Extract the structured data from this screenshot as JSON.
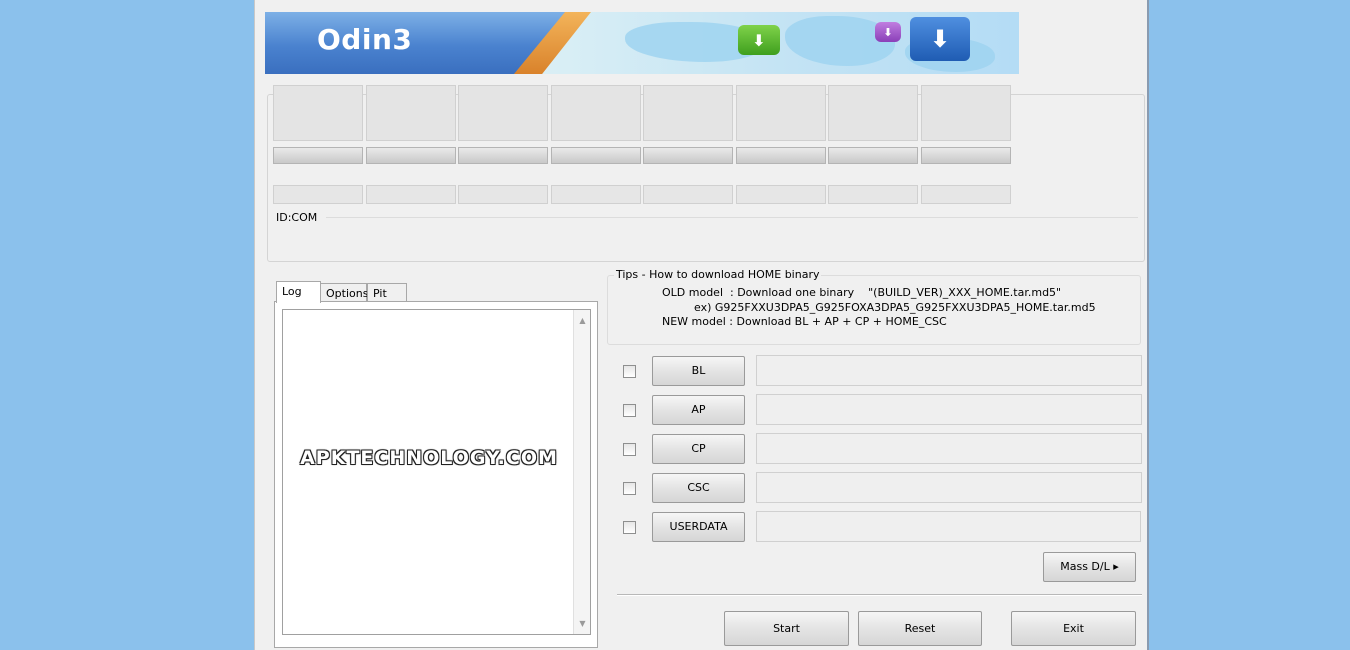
{
  "banner": {
    "title": "Odin3"
  },
  "ports": {
    "id_com_label": "ID:COM"
  },
  "tabs": [
    {
      "label": "Log",
      "active": true
    },
    {
      "label": "Options",
      "active": false
    },
    {
      "label": "Pit",
      "active": false
    }
  ],
  "log": {
    "content": "",
    "watermark": "APKTECHNOLOGY.COM"
  },
  "tips": {
    "title": "Tips - How to download HOME binary",
    "line1": "OLD model  : Download one binary    \"(BUILD_VER)_XXX_HOME.tar.md5\"",
    "line2": "ex) G925FXXU3DPA5_G925FOXA3DPA5_G925FXXU3DPA5_HOME.tar.md5",
    "line3": "NEW model : Download BL + AP + CP + HOME_CSC"
  },
  "files": [
    {
      "label": "BL",
      "checked": false,
      "path": ""
    },
    {
      "label": "AP",
      "checked": false,
      "path": ""
    },
    {
      "label": "CP",
      "checked": false,
      "path": ""
    },
    {
      "label": "CSC",
      "checked": false,
      "path": ""
    },
    {
      "label": "USERDATA",
      "checked": false,
      "path": ""
    }
  ],
  "buttons": {
    "mass_dl": "Mass D/L ▸",
    "start": "Start",
    "reset": "Reset",
    "exit": "Exit"
  }
}
